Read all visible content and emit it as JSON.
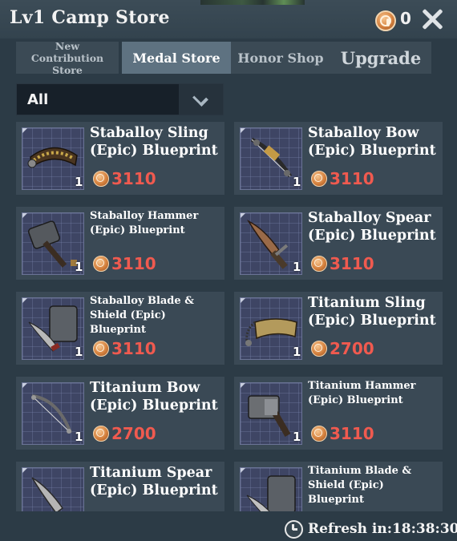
{
  "header": {
    "title": "Lv1 Camp Store",
    "medal_count": "0"
  },
  "tabs": [
    {
      "label": "New Contribution Store",
      "active": false
    },
    {
      "label": "Medal Store",
      "active": true
    },
    {
      "label": "Honor Shop",
      "active": false
    },
    {
      "label": "Upgrade",
      "active": false
    }
  ],
  "filter": {
    "selected": "All"
  },
  "items": [
    {
      "name": "Staballoy Sling (Epic) Blueprint",
      "qty": "1",
      "price": "3110",
      "icon": "sling-icon"
    },
    {
      "name": "Staballoy Bow (Epic) Blueprint",
      "qty": "1",
      "price": "3110",
      "icon": "bow-icon"
    },
    {
      "name": "Staballoy Hammer (Epic) Blueprint",
      "qty": "1",
      "price": "3110",
      "icon": "hammer-icon"
    },
    {
      "name": "Staballoy Spear (Epic) Blueprint",
      "qty": "1",
      "price": "3110",
      "icon": "spear-icon"
    },
    {
      "name": "Staballoy Blade & Shield (Epic) Blueprint",
      "qty": "1",
      "price": "3110",
      "icon": "blade-shield-icon"
    },
    {
      "name": "Titanium Sling (Epic) Blueprint",
      "qty": "1",
      "price": "2700",
      "icon": "sling-icon"
    },
    {
      "name": "Titanium Bow (Epic) Blueprint",
      "qty": "1",
      "price": "2700",
      "icon": "bow-icon"
    },
    {
      "name": "Titanium Hammer (Epic) Blueprint",
      "qty": "1",
      "price": "3110",
      "icon": "hammer-icon"
    },
    {
      "name": "Titanium Spear (Epic) Blueprint",
      "qty": "",
      "price": "",
      "icon": "spear-icon"
    },
    {
      "name": "Titanium Blade & Shield (Epic) Blueprint",
      "qty": "",
      "price": "",
      "icon": "blade-shield-icon"
    }
  ],
  "footer": {
    "refresh_label": "Refresh in:18:38:30"
  },
  "colors": {
    "price": "#f05a4f",
    "active_tab": "#5e7281",
    "card_bg": "#3a4955"
  }
}
